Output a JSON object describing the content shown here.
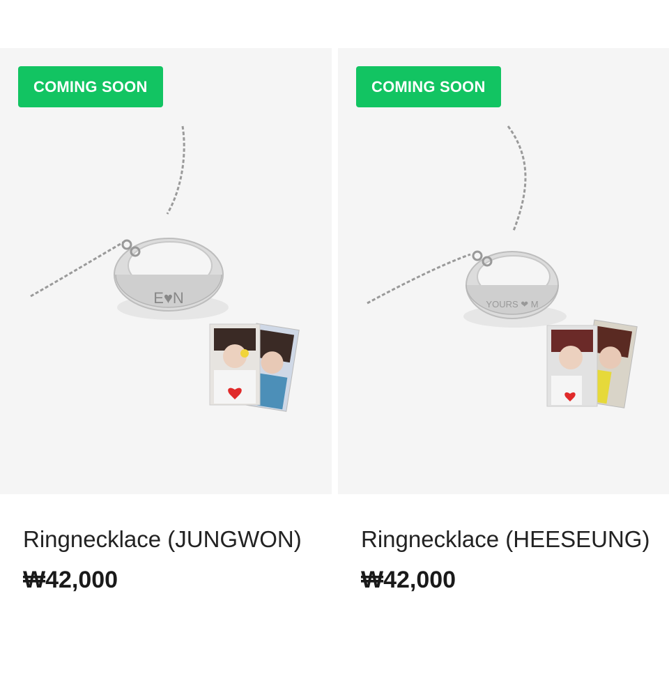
{
  "products": [
    {
      "badge": "COMING SOON",
      "name": "Ringnecklace (JUNGWON)",
      "price": "₩42,000",
      "ring_engraving": "E♥N",
      "image_alt": "JUNGWON ring necklace with photocards"
    },
    {
      "badge": "COMING SOON",
      "name": "Ringnecklace (HEESEUNG)",
      "price": "₩42,000",
      "ring_engraving": "YOURS ❤ M",
      "image_alt": "HEESEUNG ring necklace with photocards"
    }
  ],
  "colors": {
    "badge_bg": "#12c462",
    "thumb_bg": "#f5f5f5",
    "text": "#222222"
  }
}
